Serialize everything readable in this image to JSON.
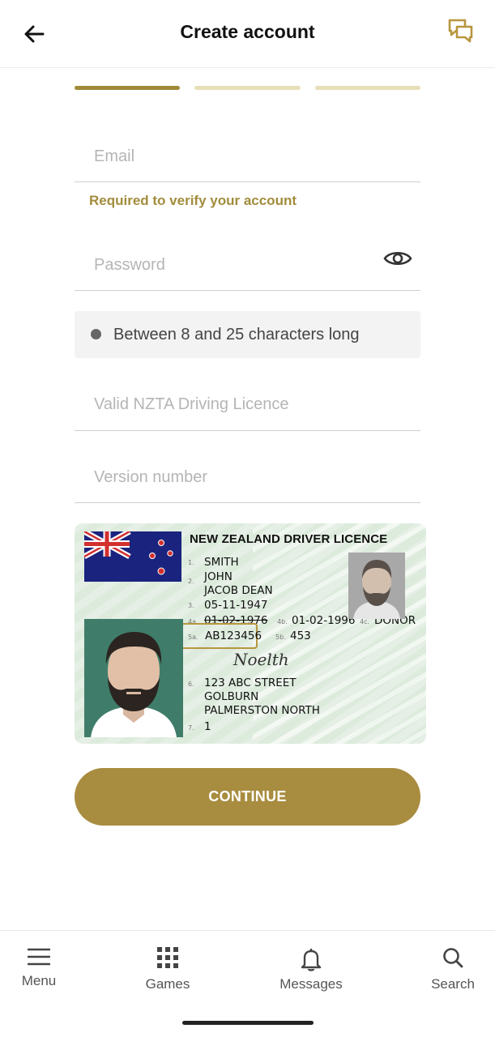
{
  "header": {
    "title": "Create account",
    "back_icon": "arrow-left-icon",
    "chat_icon": "chat-bubbles-icon",
    "accent": "#b8963e"
  },
  "progress": {
    "steps": 3,
    "current_step": 1,
    "active_color": "#9f8a38",
    "inactive_color": "#e6dfb8"
  },
  "form": {
    "email": {
      "placeholder": "Email",
      "value": ""
    },
    "email_hint": "Required to verify your account",
    "password": {
      "placeholder": "Password",
      "value": "",
      "toggle_icon": "eye-icon"
    },
    "password_rules": [
      {
        "text": "Between 8 and 25 characters long"
      }
    ],
    "licence": {
      "placeholder": "Valid NZTA Driving Licence",
      "value": ""
    },
    "version": {
      "placeholder": "Version number",
      "value": ""
    }
  },
  "licence_card": {
    "title": "NEW ZEALAND DRIVER LICENCE",
    "surname": "SMITH",
    "given_name_1": "JOHN",
    "given_name_2": "JACOB DEAN",
    "dob": "05-11-1947",
    "issue_date": "01-02-1976",
    "expiry_date": "01-02-1996",
    "donor": "DONOR",
    "licence_number": "AB123456",
    "version_number": "453",
    "signature": "Noelth",
    "address_1": "123 ABC STREET",
    "address_2": "GOLBURN",
    "address_3": "PALMERSTON NORTH",
    "class": "1",
    "field_numbers": {
      "f1": "1.",
      "f2": "2.",
      "f3": "3.",
      "f4a": "4a.",
      "f4b": "4b.",
      "f4c": "4c.",
      "f5a": "5a.",
      "f5b": "5b.",
      "f6": "6.",
      "f7": "7."
    }
  },
  "actions": {
    "continue_label": "CONTINUE",
    "continue_color": "#a88c3f"
  },
  "bottom_nav": {
    "items": [
      {
        "label": "Menu",
        "icon": "hamburger-icon"
      },
      {
        "label": "Games",
        "icon": "grid-icon"
      },
      {
        "label": "Messages",
        "icon": "bell-icon"
      },
      {
        "label": "Search",
        "icon": "search-icon"
      }
    ]
  }
}
